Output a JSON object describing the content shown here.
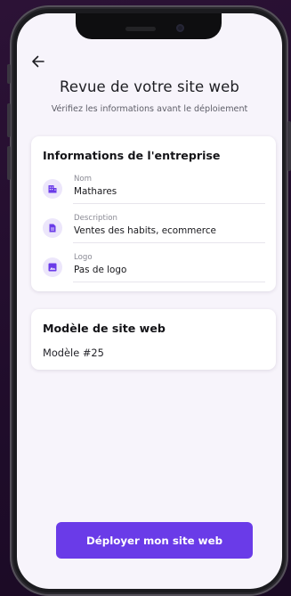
{
  "header": {
    "title": "Revue de votre site web",
    "subtitle": "Vérifiez les informations avant le déploiement",
    "back_icon": "arrow-left-icon"
  },
  "company_card": {
    "title": "Informations de l'entreprise",
    "fields": [
      {
        "label": "Nom",
        "value": "Mathares",
        "icon": "building-icon"
      },
      {
        "label": "Description",
        "value": "Ventes des habits, ecommerce",
        "icon": "document-icon"
      },
      {
        "label": "Logo",
        "value": "Pas de logo",
        "icon": "image-icon"
      }
    ]
  },
  "template_card": {
    "title": "Modèle de site web",
    "value": "Modèle #25"
  },
  "actions": {
    "deploy_label": "Déployer mon site web"
  },
  "colors": {
    "accent": "#6a3be8",
    "icon_background": "#ece6fb",
    "screen_background": "#f7f4fb",
    "card_background": "#ffffff",
    "frame": "#1b1b1f",
    "page_background": "#24102e"
  }
}
